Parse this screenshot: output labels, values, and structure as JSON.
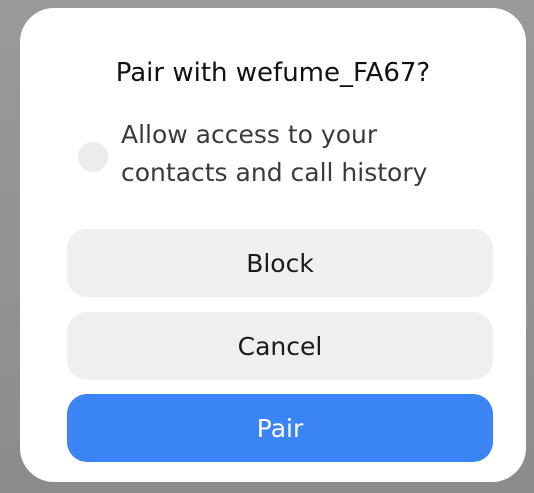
{
  "dialog": {
    "title": "Pair with wefume_FA67?",
    "option": {
      "label": "Allow access to your contacts and call history",
      "checked": false
    },
    "buttons": {
      "block": "Block",
      "cancel": "Cancel",
      "pair": "Pair"
    }
  },
  "colors": {
    "primary": "#3b84f6",
    "button_bg": "#efefef",
    "overlay": "#8e8e8e"
  }
}
